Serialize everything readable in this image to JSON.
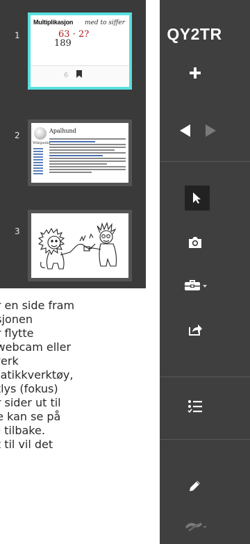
{
  "session": {
    "code": "QY2TR"
  },
  "slides": [
    {
      "number": "1",
      "title": "Multiplikasjon",
      "handwriting": "med to siffer",
      "math_top": "63 · 2?",
      "math_bottom": "189",
      "page": "6",
      "selected": true
    },
    {
      "number": "2",
      "wiki_word": "Wikipedia",
      "title": "Apalhund"
    },
    {
      "number": "3"
    }
  ],
  "description_lines": [
    "er en side fram",
    "ksjonen",
    "er flytte",
    "l webcam eller",
    "rverk",
    "matikkverktøy,",
    "otlys (fokus)",
    "er sider ut til",
    " de kan se på",
    "re tilbake.",
    "et til vil det"
  ],
  "colors": {
    "panel_bg": "#3a3a3a",
    "toolbar_bg": "#3f3f3f",
    "selected_border": "#5ae0e0",
    "active_tool_bg": "#222222"
  },
  "toolbar_icons": [
    "plus-icon",
    "arrow-left-icon",
    "arrow-right-icon",
    "cursor-icon",
    "camera-icon",
    "toolbox-icon",
    "share-icon",
    "list-icon",
    "pen-icon",
    "drawing-tools-icon"
  ]
}
